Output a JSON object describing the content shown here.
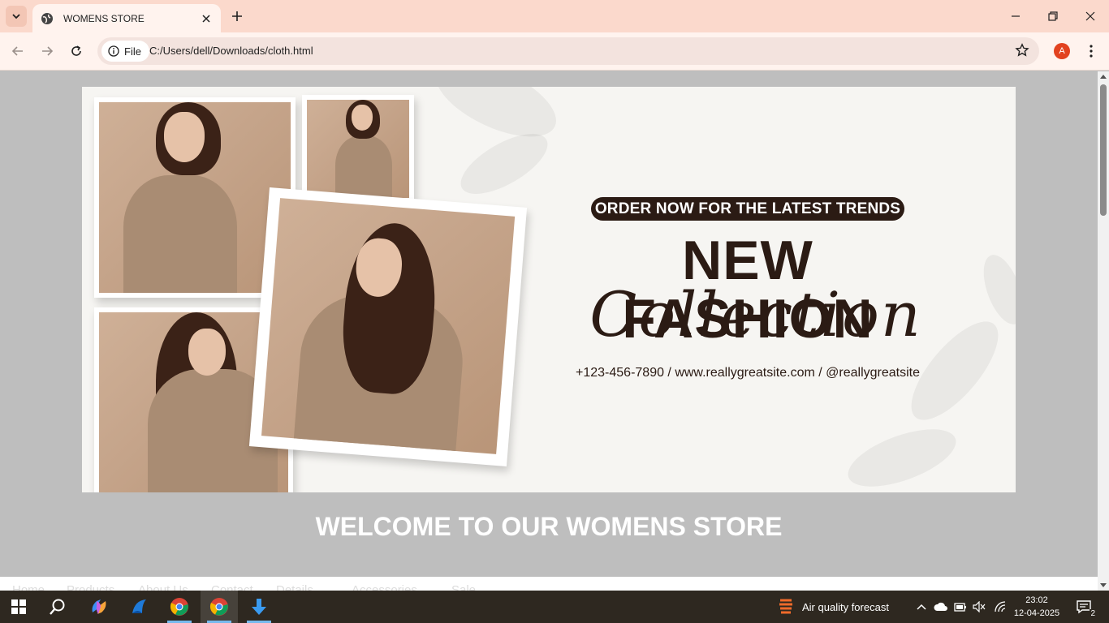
{
  "browser": {
    "tab_title": "WOMENS STORE",
    "chip_label": "File",
    "url": "C:/Users/dell/Downloads/cloth.html",
    "profile_initial": "A"
  },
  "banner": {
    "pill_text": "ORDER NOW FOR THE LATEST TRENDS",
    "headline": "NEW FASHION",
    "script_text": "Collection",
    "contact": "+123-456-7890 / www.reallygreatsite.com / @reallygreatsite"
  },
  "page": {
    "welcome": "WELCOME TO OUR WOMENS STORE",
    "nav": [
      "Home",
      "Products",
      "About Us",
      "Contact",
      "Details",
      "Accessories",
      "Sale"
    ]
  },
  "taskbar": {
    "weather": "Air quality forecast",
    "time": "23:02",
    "date": "12-04-2025",
    "notifications": "2"
  },
  "colors": {
    "tabstrip": "#fbd9cc",
    "toolbar": "#fff3ee",
    "page_bg": "#bebebe",
    "banner_bg": "#f6f5f2",
    "dark_brown": "#2b1b14",
    "taskbar": "#2e2820"
  }
}
